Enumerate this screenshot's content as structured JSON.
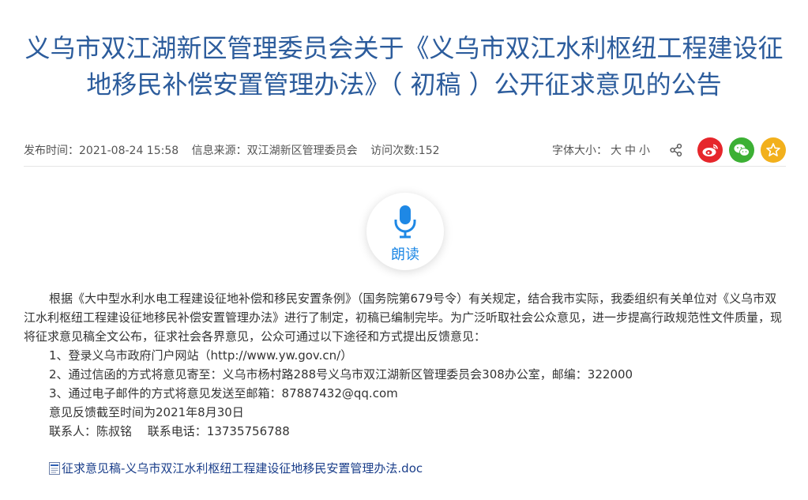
{
  "article": {
    "title": "义乌市双江湖新区管理委员会关于《义乌市双江水利枢纽工程建设征地移民补偿安置管理办法》（ 初稿 ）公开征求意见的公告",
    "publish_time": "发布时间：2021-08-24 15:58",
    "source": "信息来源：双江湖新区管理委员会",
    "visits": "访问次数:152"
  },
  "toolbar": {
    "font_size_label": "字体大小：",
    "font_large": "大",
    "font_medium": "中",
    "font_small": "小",
    "share_icon": "share-icon",
    "weibo_icon": "weibo-icon",
    "wechat_icon": "wechat-icon",
    "favorite_icon": "star-icon"
  },
  "reader": {
    "label": "朗读",
    "icon": "microphone-icon"
  },
  "body": {
    "intro": "根据《大中型水利水电工程建设征地补偿和移民安置条例》（国务院第679号令）有关规定，结合我市实际，我委组织有关单位对《义乌市双江水利枢纽工程建设征地移民补偿安置管理办法》进行了制定，初稿已编制完毕。为广泛听取社会公众意见，进一步提高行政规范性文件质量，现将征求意见稿全文公布，征求社会各界意见，公众可通过以下途径和方式提出反馈意见：",
    "item1": "1、登录义乌市政府门户网站（http://www.yw.gov.cn/）",
    "item2": "2、通过信函的方式将意见寄至：义乌市杨村路288号义乌市双江湖新区管理委员会308办公室，邮编：322000",
    "item3": "3、通过电子邮件的方式将意见发送至邮箱：87887432@qq.com",
    "deadline": "意见反馈截至时间为2021年8月30日",
    "contact": "联系人：陈叔铭　 联系电话：13735756788"
  },
  "attachment": {
    "filename": "征求意见稿-义乌市双江水利枢纽工程建设征地移民安置管理办法.doc",
    "icon": "doc-file-icon"
  },
  "colors": {
    "title": "#2c5c9c",
    "weibo": "#e6262b",
    "wechat": "#3cb034",
    "favorite": "#f2b01c",
    "reader_accent": "#1e88e5",
    "link": "#1a3e8a"
  }
}
